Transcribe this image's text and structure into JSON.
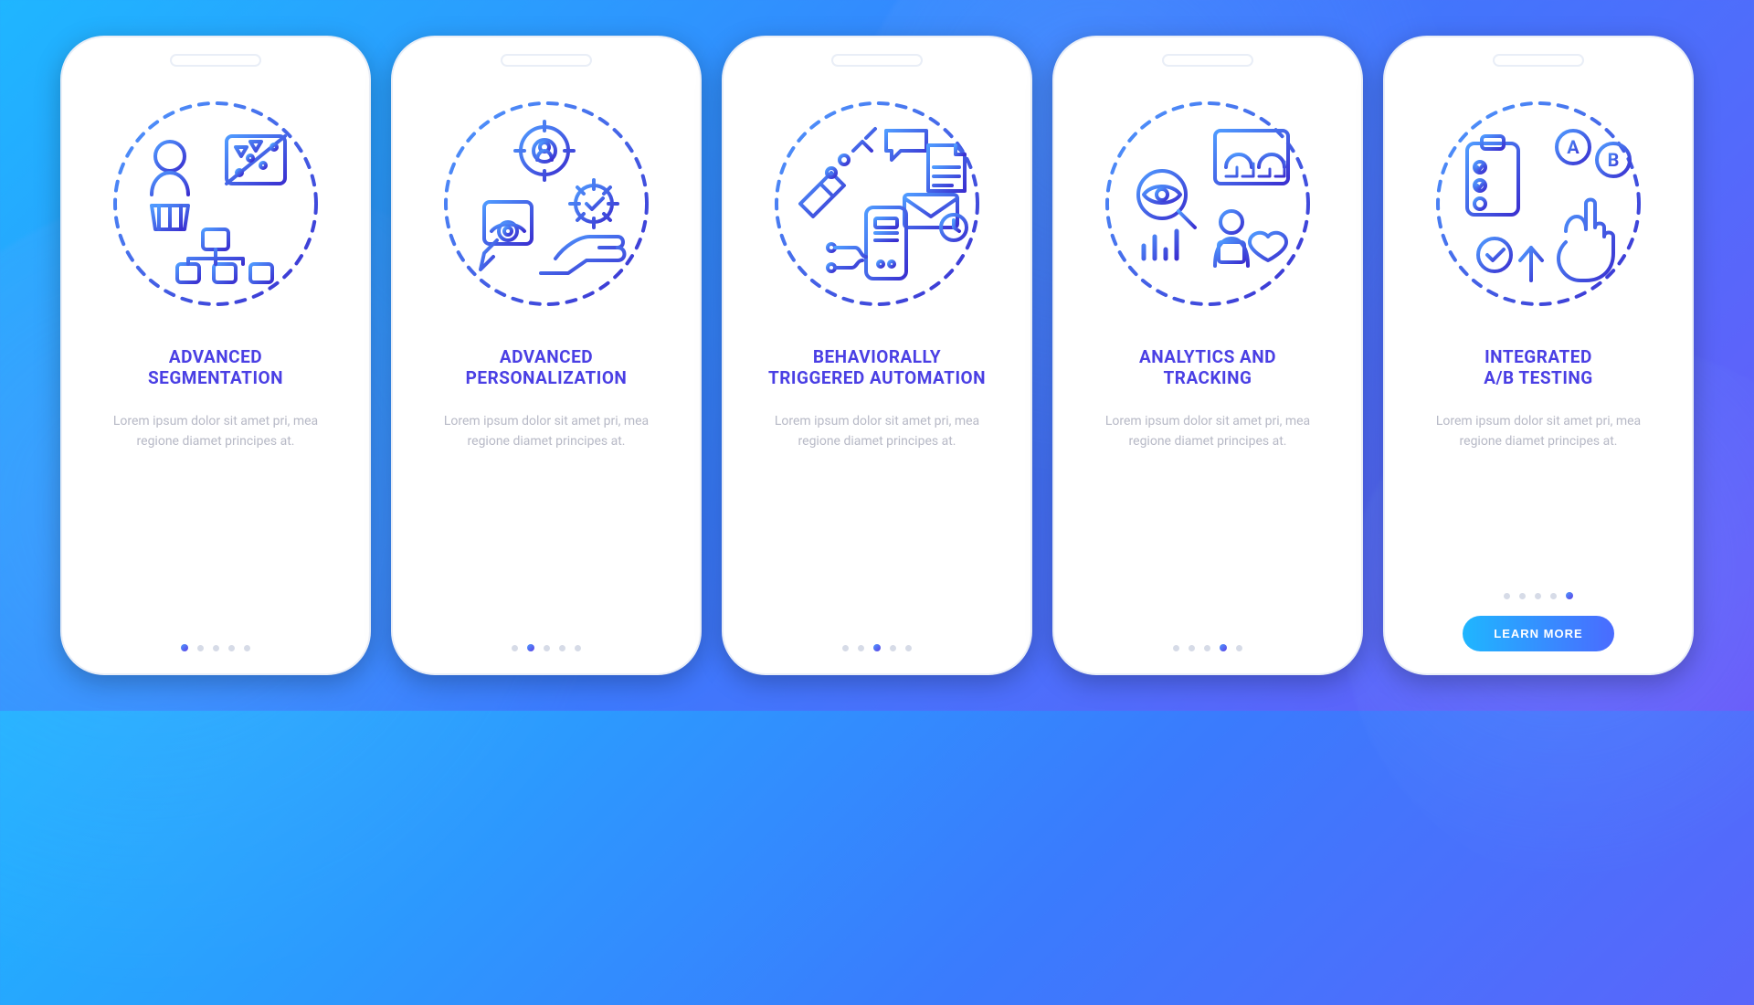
{
  "colors": {
    "title": "#4a3fe4",
    "desc": "#b7b9c6",
    "cta_from": "#1fb6ff",
    "cta_to": "#4a6bff",
    "icon_from": "#4f9bff",
    "icon_to": "#3a2fd0"
  },
  "cta_label": "LEARN MORE",
  "screens": [
    {
      "title": "ADVANCED\nSEGMENTATION",
      "desc": "Lorem ipsum dolor sit amet pri, mea regione diamet principes at.",
      "icon": "segmentation-icon",
      "has_cta": false
    },
    {
      "title": "ADVANCED\nPERSONALIZATION",
      "desc": "Lorem ipsum dolor sit amet pri, mea regione diamet principes at.",
      "icon": "personalization-icon",
      "has_cta": false
    },
    {
      "title": "BEHAVIORALLY\nTRIGGERED AUTOMATION",
      "desc": "Lorem ipsum dolor sit amet pri, mea regione diamet principes at.",
      "icon": "automation-icon",
      "has_cta": false
    },
    {
      "title": "ANALYTICS AND\nTRACKING",
      "desc": "Lorem ipsum dolor sit amet pri, mea regione diamet principes at.",
      "icon": "analytics-icon",
      "has_cta": false
    },
    {
      "title": "INTEGRATED\nA/B TESTING",
      "desc": "Lorem ipsum dolor sit amet pri, mea regione diamet principes at.",
      "icon": "abtesting-icon",
      "has_cta": true
    }
  ],
  "pagination_count": 5
}
